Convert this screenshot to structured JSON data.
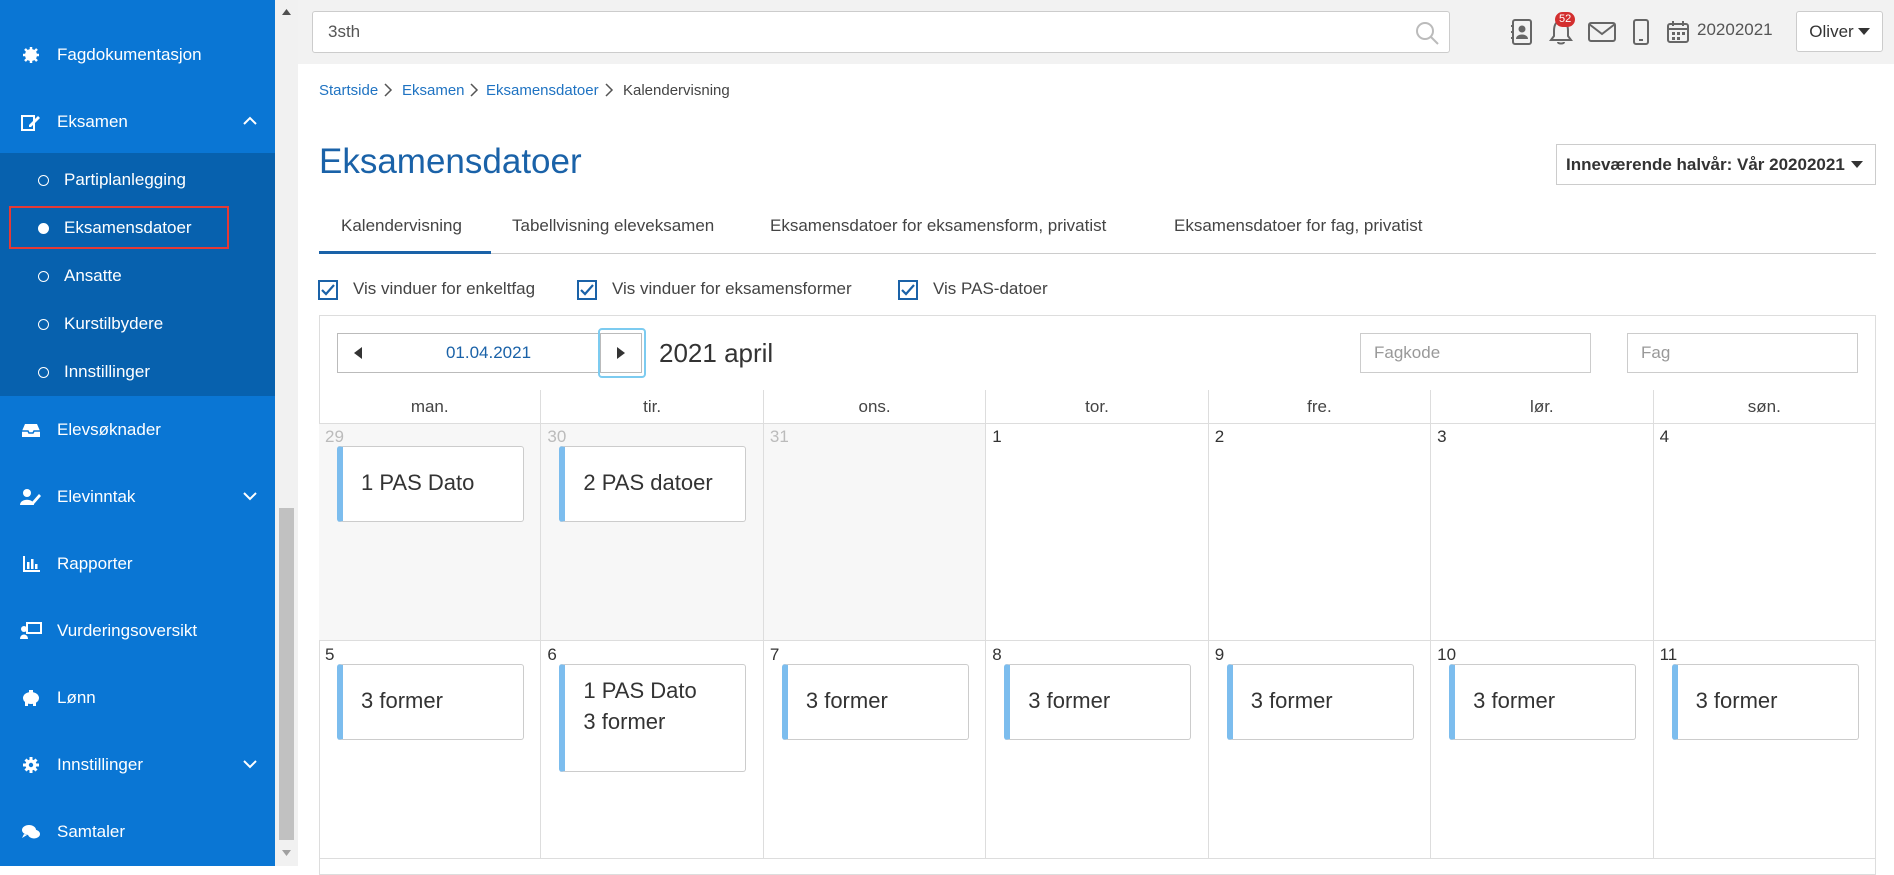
{
  "sidebar": {
    "items": [
      {
        "label": "Fagdokumentasjon",
        "icon": "gear-badge-icon"
      },
      {
        "label": "Eksamen",
        "icon": "exam-edit-icon"
      },
      {
        "label": "Elevsøknader",
        "icon": "inbox-icon"
      },
      {
        "label": "Elevinntak",
        "icon": "user-edit-icon"
      },
      {
        "label": "Rapporter",
        "icon": "bar-chart-icon"
      },
      {
        "label": "Vurderingsoversikt",
        "icon": "presentation-icon"
      },
      {
        "label": "Lønn",
        "icon": "piggy-bank-icon"
      },
      {
        "label": "Innstillinger",
        "icon": "gear-icon"
      },
      {
        "label": "Samtaler",
        "icon": "chat-icon"
      }
    ],
    "eksamen_sub": [
      {
        "label": "Partiplanlegging"
      },
      {
        "label": "Eksamensdatoer"
      },
      {
        "label": "Ansatte"
      },
      {
        "label": "Kurstilbydere"
      },
      {
        "label": "Innstillinger"
      }
    ]
  },
  "topbar": {
    "search_value": "3sth",
    "notification_count": "52",
    "school_year": "20202021",
    "user": "Oliver"
  },
  "breadcrumb": [
    "Startside",
    "Eksamen",
    "Eksamensdatoer",
    "Kalendervisning"
  ],
  "page": {
    "title": "Eksamensdatoer",
    "semester_select": "Inneværende halvår: Vår 20202021"
  },
  "tabs": [
    "Kalendervisning",
    "Tabellvisning eleveksamen",
    "Eksamensdatoer for eksamensform, privatist",
    "Eksamensdatoer for fag, privatist"
  ],
  "checkboxes": [
    {
      "label": "Vis vinduer for enkeltfag",
      "checked": true
    },
    {
      "label": "Vis vinduer for eksamensformer",
      "checked": true
    },
    {
      "label": "Vis PAS-datoer",
      "checked": true
    }
  ],
  "calendar": {
    "date_value": "01.04.2021",
    "title": "2021 april",
    "fagkode_placeholder": "Fagkode",
    "fag_placeholder": "Fag",
    "day_headers": [
      "man.",
      "tir.",
      "ons.",
      "tor.",
      "fre.",
      "lør.",
      "søn."
    ],
    "weeks": [
      [
        {
          "day": "29",
          "muted": true,
          "event": "1 PAS Dato"
        },
        {
          "day": "30",
          "muted": true,
          "event": "2 PAS datoer"
        },
        {
          "day": "31",
          "muted": true,
          "event": ""
        },
        {
          "day": "1",
          "muted": false,
          "event": ""
        },
        {
          "day": "2",
          "muted": false,
          "event": ""
        },
        {
          "day": "3",
          "muted": false,
          "event": ""
        },
        {
          "day": "4",
          "muted": false,
          "event": ""
        }
      ],
      [
        {
          "day": "5",
          "muted": false,
          "event": "3 former"
        },
        {
          "day": "6",
          "muted": false,
          "event": "1 PAS Dato\n3 former"
        },
        {
          "day": "7",
          "muted": false,
          "event": "3 former"
        },
        {
          "day": "8",
          "muted": false,
          "event": "3 former"
        },
        {
          "day": "9",
          "muted": false,
          "event": "3 former"
        },
        {
          "day": "10",
          "muted": false,
          "event": "3 former"
        },
        {
          "day": "11",
          "muted": false,
          "event": "3 former"
        }
      ]
    ]
  },
  "colors": {
    "sidebar": "#0a76d4",
    "sidebar_sub": "#0761ae",
    "accent": "#1a62a8",
    "event_bar": "#7cbdee",
    "highlight": "#e53935"
  }
}
